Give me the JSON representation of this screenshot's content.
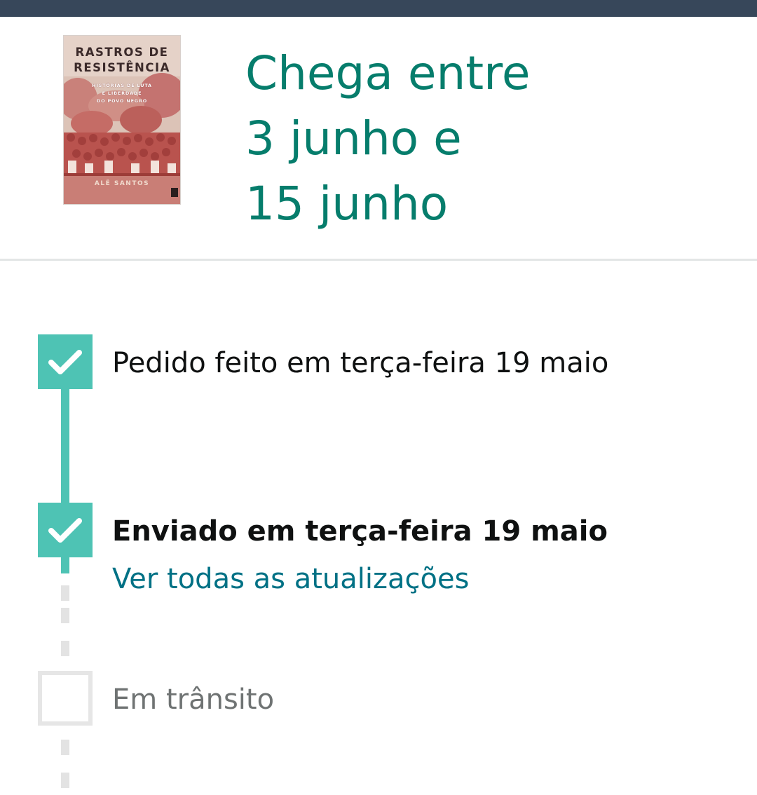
{
  "book": {
    "cover_title_line1": "RASTROS DE",
    "cover_title_line2": "RESISTÊNCIA",
    "cover_subtitle_line1": "HISTÓRIAS DE LUTA",
    "cover_subtitle_line2": "E LIBERDADE",
    "cover_subtitle_line3": "DO POVO NEGRO",
    "cover_author": "ALÊ SANTOS"
  },
  "arrival": {
    "line1": "Chega entre",
    "line2": "3 junho e",
    "line3": "15 junho"
  },
  "timeline": {
    "steps": [
      {
        "label": "Pedido feito em terça-feira 19 maio",
        "status": "done"
      },
      {
        "label": "Enviado em terça-feira 19 maio",
        "status": "done",
        "link": "Ver todas as atualizações"
      },
      {
        "label": "Em trânsito",
        "status": "pending"
      }
    ]
  },
  "colors": {
    "top_bar": "#37475a",
    "arrival_text": "#067d6c",
    "step_done": "#4ec3b4",
    "step_pending_border": "#e6e6e6",
    "link": "#007185"
  }
}
